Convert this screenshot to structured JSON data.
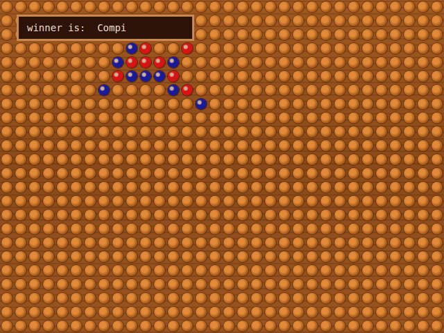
{
  "message": {
    "label": "winner is:  Compi"
  },
  "board": {
    "columns": 32,
    "rows": 24
  },
  "pegs": [
    {
      "col": 9,
      "row": 3,
      "color": "#1a1a9a"
    },
    {
      "col": 10,
      "row": 3,
      "color": "#d81414"
    },
    {
      "col": 13,
      "row": 3,
      "color": "#d81414"
    },
    {
      "col": 8,
      "row": 4,
      "color": "#1a1a9a"
    },
    {
      "col": 9,
      "row": 4,
      "color": "#d81414"
    },
    {
      "col": 10,
      "row": 4,
      "color": "#d81414"
    },
    {
      "col": 11,
      "row": 4,
      "color": "#d81414"
    },
    {
      "col": 12,
      "row": 4,
      "color": "#1a1a9a"
    },
    {
      "col": 8,
      "row": 5,
      "color": "#d81414"
    },
    {
      "col": 9,
      "row": 5,
      "color": "#1a1a9a"
    },
    {
      "col": 10,
      "row": 5,
      "color": "#1a1a9a"
    },
    {
      "col": 11,
      "row": 5,
      "color": "#1a1a9a"
    },
    {
      "col": 12,
      "row": 5,
      "color": "#d81414"
    },
    {
      "col": 7,
      "row": 6,
      "color": "#1a1a9a"
    },
    {
      "col": 12,
      "row": 6,
      "color": "#1a1a9a"
    },
    {
      "col": 13,
      "row": 6,
      "color": "#d81414"
    },
    {
      "col": 14,
      "row": 7,
      "color": "#1a1a9a"
    }
  ]
}
